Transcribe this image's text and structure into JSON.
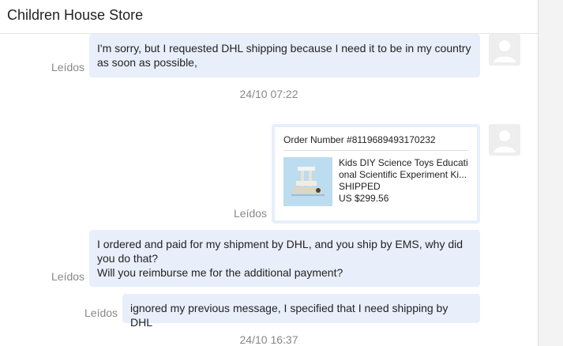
{
  "header": {
    "title": "Children House Store"
  },
  "messages": [
    {
      "lines": [
        "I'm sorry, but I requested DHL shipping because I need it to be in my country",
        "as soon as possible,"
      ],
      "read_label": "Leídos"
    },
    {
      "read_label": "Leídos"
    },
    {
      "lines": [
        "I ordered and paid for my shipment by DHL, and you ship by EMS, why did",
        "you do that?",
        "Will you reimburse me for the additional payment?"
      ],
      "read_label": "Leídos"
    },
    {
      "lines": [
        "ignored my previous message, I specified that I need shipping by DHL"
      ],
      "read_label": "Leídos"
    }
  ],
  "timestamps": [
    "24/10 07:22",
    "24/10 16:37"
  ],
  "order": {
    "number_label": "Order Number #8119689493170232",
    "product_title_lines": [
      "Kids DIY Science Toys Educati",
      "onal Scientific Experiment Ki..."
    ],
    "status": "SHIPPED",
    "price": "US $299.56"
  },
  "icons": {
    "avatar": "user-avatar-icon",
    "product": "product-thumbnail-icon"
  },
  "colors": {
    "bubble": "#e8effb",
    "muted_text": "#888888"
  }
}
